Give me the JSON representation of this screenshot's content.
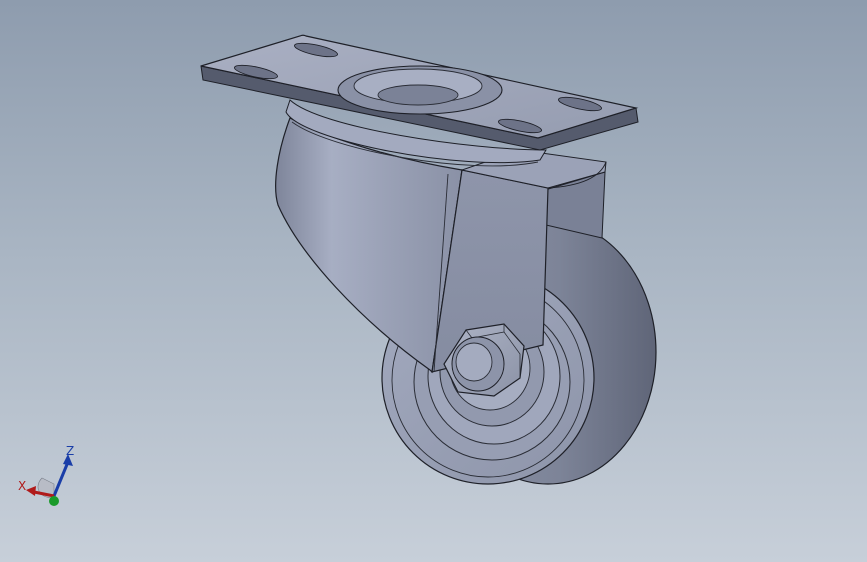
{
  "viewport": {
    "part": "caster-wheel-assembly",
    "colors": {
      "background_top": "#8e9cae",
      "background_bottom": "#c7cfd9",
      "metal_light": "#a4abc0",
      "metal_mid": "#8c93a8",
      "metal_dark": "#5f6578",
      "edge": "#1e2028"
    }
  },
  "triad": {
    "z_label": "Z",
    "x_label": "X",
    "colors": {
      "z": "#1a3ea8",
      "x": "#b01a1a",
      "y": "#1a9a2a"
    }
  }
}
